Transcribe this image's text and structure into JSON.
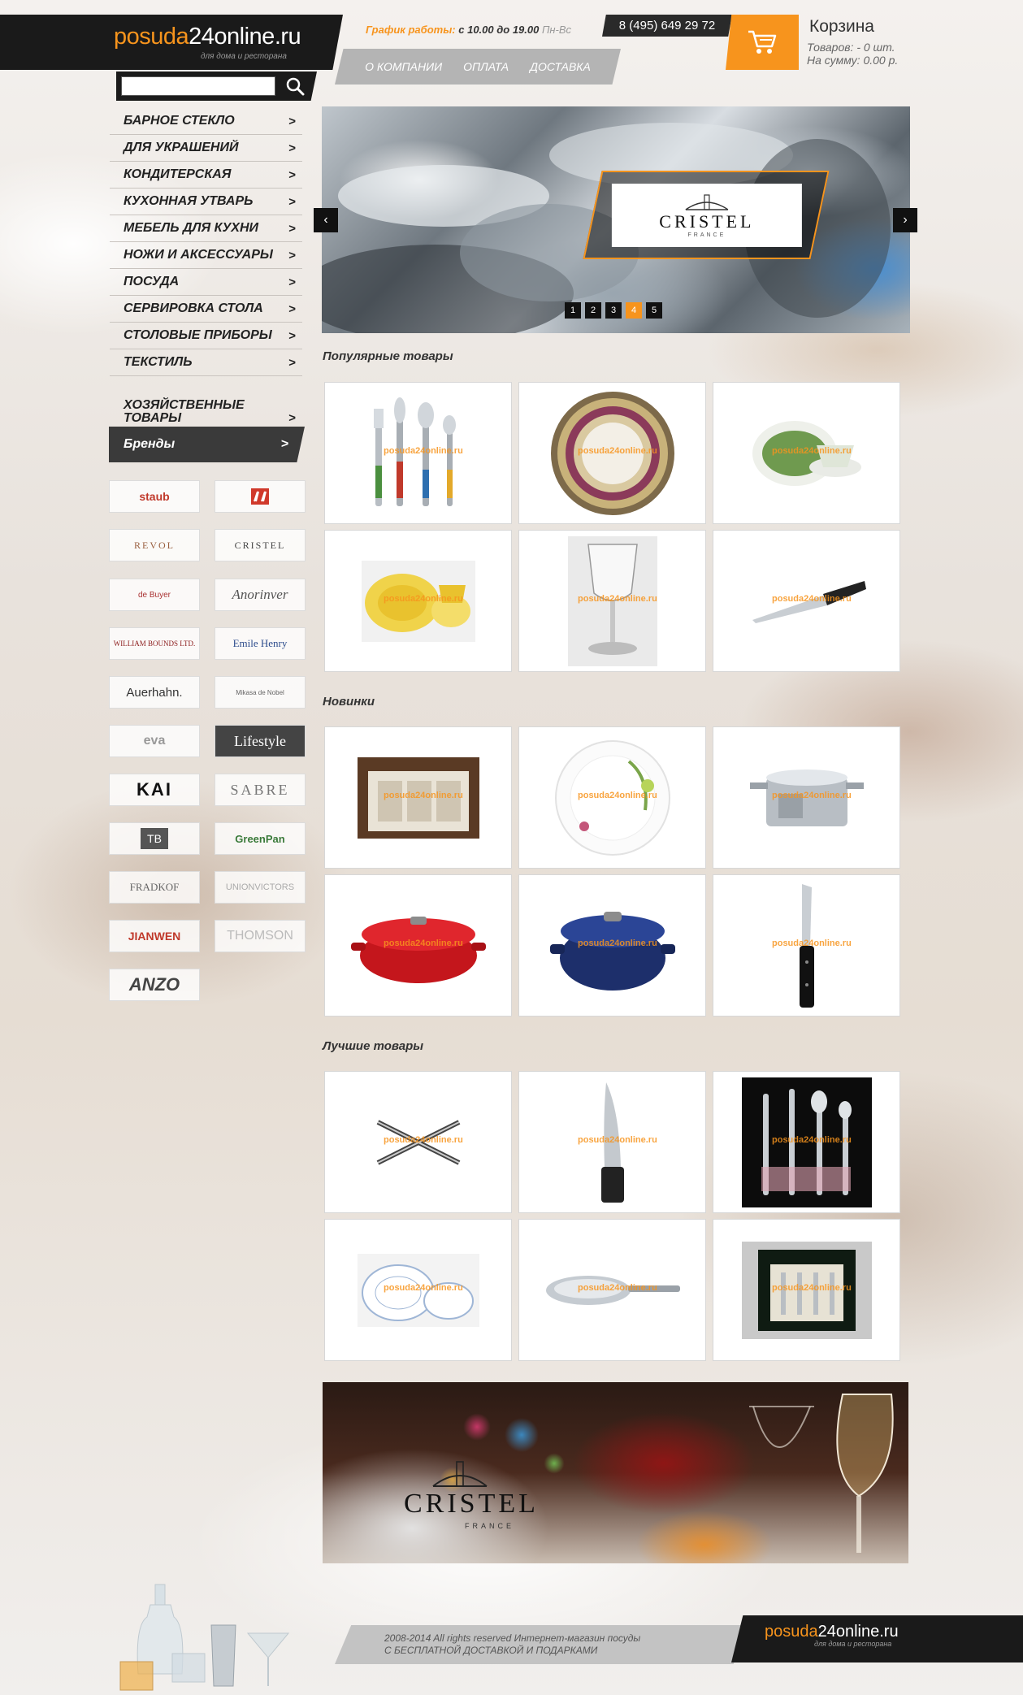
{
  "header": {
    "logo_brand": "posuda",
    "logo_rest": "24online.ru",
    "logo_tagline": "для дома и ресторана",
    "schedule_label": "График работы:",
    "schedule_time": "с 10.00 до 19.00",
    "schedule_days": "Пн-Вс",
    "phone": "8 (495) 649 29 72",
    "nav": [
      "О КОМПАНИИ",
      "ОПЛАТА",
      "ДОСТАВКА"
    ]
  },
  "cart": {
    "title": "Корзина",
    "items_text": "Товаров: - 0 шт.",
    "sum_text": "На сумму: 0.00 р.",
    "icon": "cart-icon"
  },
  "search": {
    "value": "",
    "icon": "search-icon"
  },
  "categories": [
    "БАРНОЕ СТЕКЛО",
    "ДЛЯ УКРАШЕНИЙ",
    "КОНДИТЕРСКАЯ",
    "КУХОННАЯ УТВАРЬ",
    "МЕБЕЛЬ ДЛЯ КУХНИ",
    "НОЖИ И АКСЕССУАРЫ",
    "ПОСУДА",
    "СЕРВИРОВКА СТОЛА",
    "СТОЛОВЫЕ ПРИБОРЫ",
    "ТЕКСТИЛЬ",
    "ХОЗЯЙСТВЕННЫЕ ТОВАРЫ"
  ],
  "category_arrow": ">",
  "brands": {
    "title": "Бренды",
    "arrow": ">",
    "items": [
      "staub",
      "ZWILLING",
      "REVOL",
      "CRISTEL",
      "de Buyer",
      "Anorinver",
      "WILLIAM BOUNDS LTD.",
      "Emile Henry",
      "Auerhahn.",
      "Mikasa de Nobel",
      "eva",
      "Lifestyle",
      "KAI",
      "SABRE",
      "TB",
      "GreenPan",
      "FRADKOF",
      "UNIONVICTORS",
      "JIANWEN",
      "THOMSON",
      "ANZO"
    ]
  },
  "slider": {
    "brand": "CRISTEL",
    "brand_sub": "FRANCE",
    "prev": "‹",
    "next": "›",
    "dots": [
      "1",
      "2",
      "3",
      "4",
      "5"
    ],
    "active_dot": "4"
  },
  "sections": {
    "popular": "Популярные товары",
    "new": "Новинки",
    "best": "Лучшие товары"
  },
  "watermark": "posuda24online.ru",
  "products": {
    "popular": [
      "cutlery-set",
      "decorated-plate",
      "cup-and-saucer",
      "yellow-dinnerware",
      "wine-glass",
      "chef-knife"
    ],
    "new": [
      "gift-box-set",
      "floral-plate",
      "steel-saucepan",
      "red-oval-cocotte",
      "blue-round-cocotte",
      "kitchen-knife"
    ],
    "best": [
      "trivet",
      "pepper-mill",
      "cutlery-black-box",
      "porcelain-dinnerware",
      "steel-frying-pan",
      "gift-box-spoons"
    ]
  },
  "banner": {
    "brand": "CRISTEL",
    "brand_sub": "FRANCE"
  },
  "footer": {
    "copyright": "2008-2014 All rights reserved Интернет-магазин посуды",
    "slogan": "С БЕСПЛАТНОЙ ДОСТАВКОЙ И ПОДАРКАМИ",
    "logo_brand": "posuda",
    "logo_rest": "24online.ru",
    "logo_tagline": "для дома и ресторана"
  },
  "colors": {
    "accent": "#f7941d",
    "dark": "#1a1a1a",
    "nav_gray": "#b4b4b4"
  }
}
